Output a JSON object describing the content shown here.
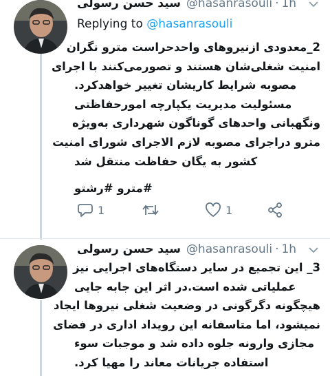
{
  "tweets": [
    {
      "author_name": "سید حسن رسولی",
      "handle": "@hasanrasouli",
      "separator": "·",
      "time": "1h",
      "replying_prefix": "Replying to",
      "replying_handle": "@hasanrasouli",
      "lines": [
        "2_معدودی ازنیروهای واحدحراست مترو نگران",
        "امنیت شغلی‌شان هستند و تصورمی‌کنند با اجرای",
        "مصوبه شرایط کاریشان تغییر خواهدکرد.",
        "مسئولیت مدیریت یکپارچه امورحفاظتی",
        "ونگهبانی واحدهای گوناگون شهرداری به‌ویژه",
        "مترو دراجرای مصوبه لازم الاجرای شورای امنیت",
        "کشور به یگان حفاظت منتقل شد"
      ],
      "hashtags": "#مترو #رشتو",
      "reply_count": "1",
      "retweet_count": "",
      "like_count": "1",
      "icons": [
        "reply-icon",
        "retweet-icon",
        "like-icon",
        "share-icon"
      ]
    },
    {
      "author_name": "سید حسن رسولی",
      "handle": "@hasanrasouli",
      "separator": "·",
      "time": "1h",
      "lines": [
        "3_ این تجمیع در سایر دستگاه‌های اجرایی نیز",
        "عملیاتی شده است.در اثر این جابه جایی",
        "هیچگونه دگرگونی در وضعیت شغلی نیروها ایجاد",
        "نمیشود، اما متاسفانه این رویداد اداری در فضای",
        "مجازی وارونه جلوه داده شد و موجبات سوء",
        "استفاده جریانات معاند را مهیا کرد."
      ]
    }
  ],
  "colors": {
    "text": "#14171a",
    "muted": "#657786",
    "link": "#1da1f2",
    "thread_line": "#ccd6dd"
  }
}
